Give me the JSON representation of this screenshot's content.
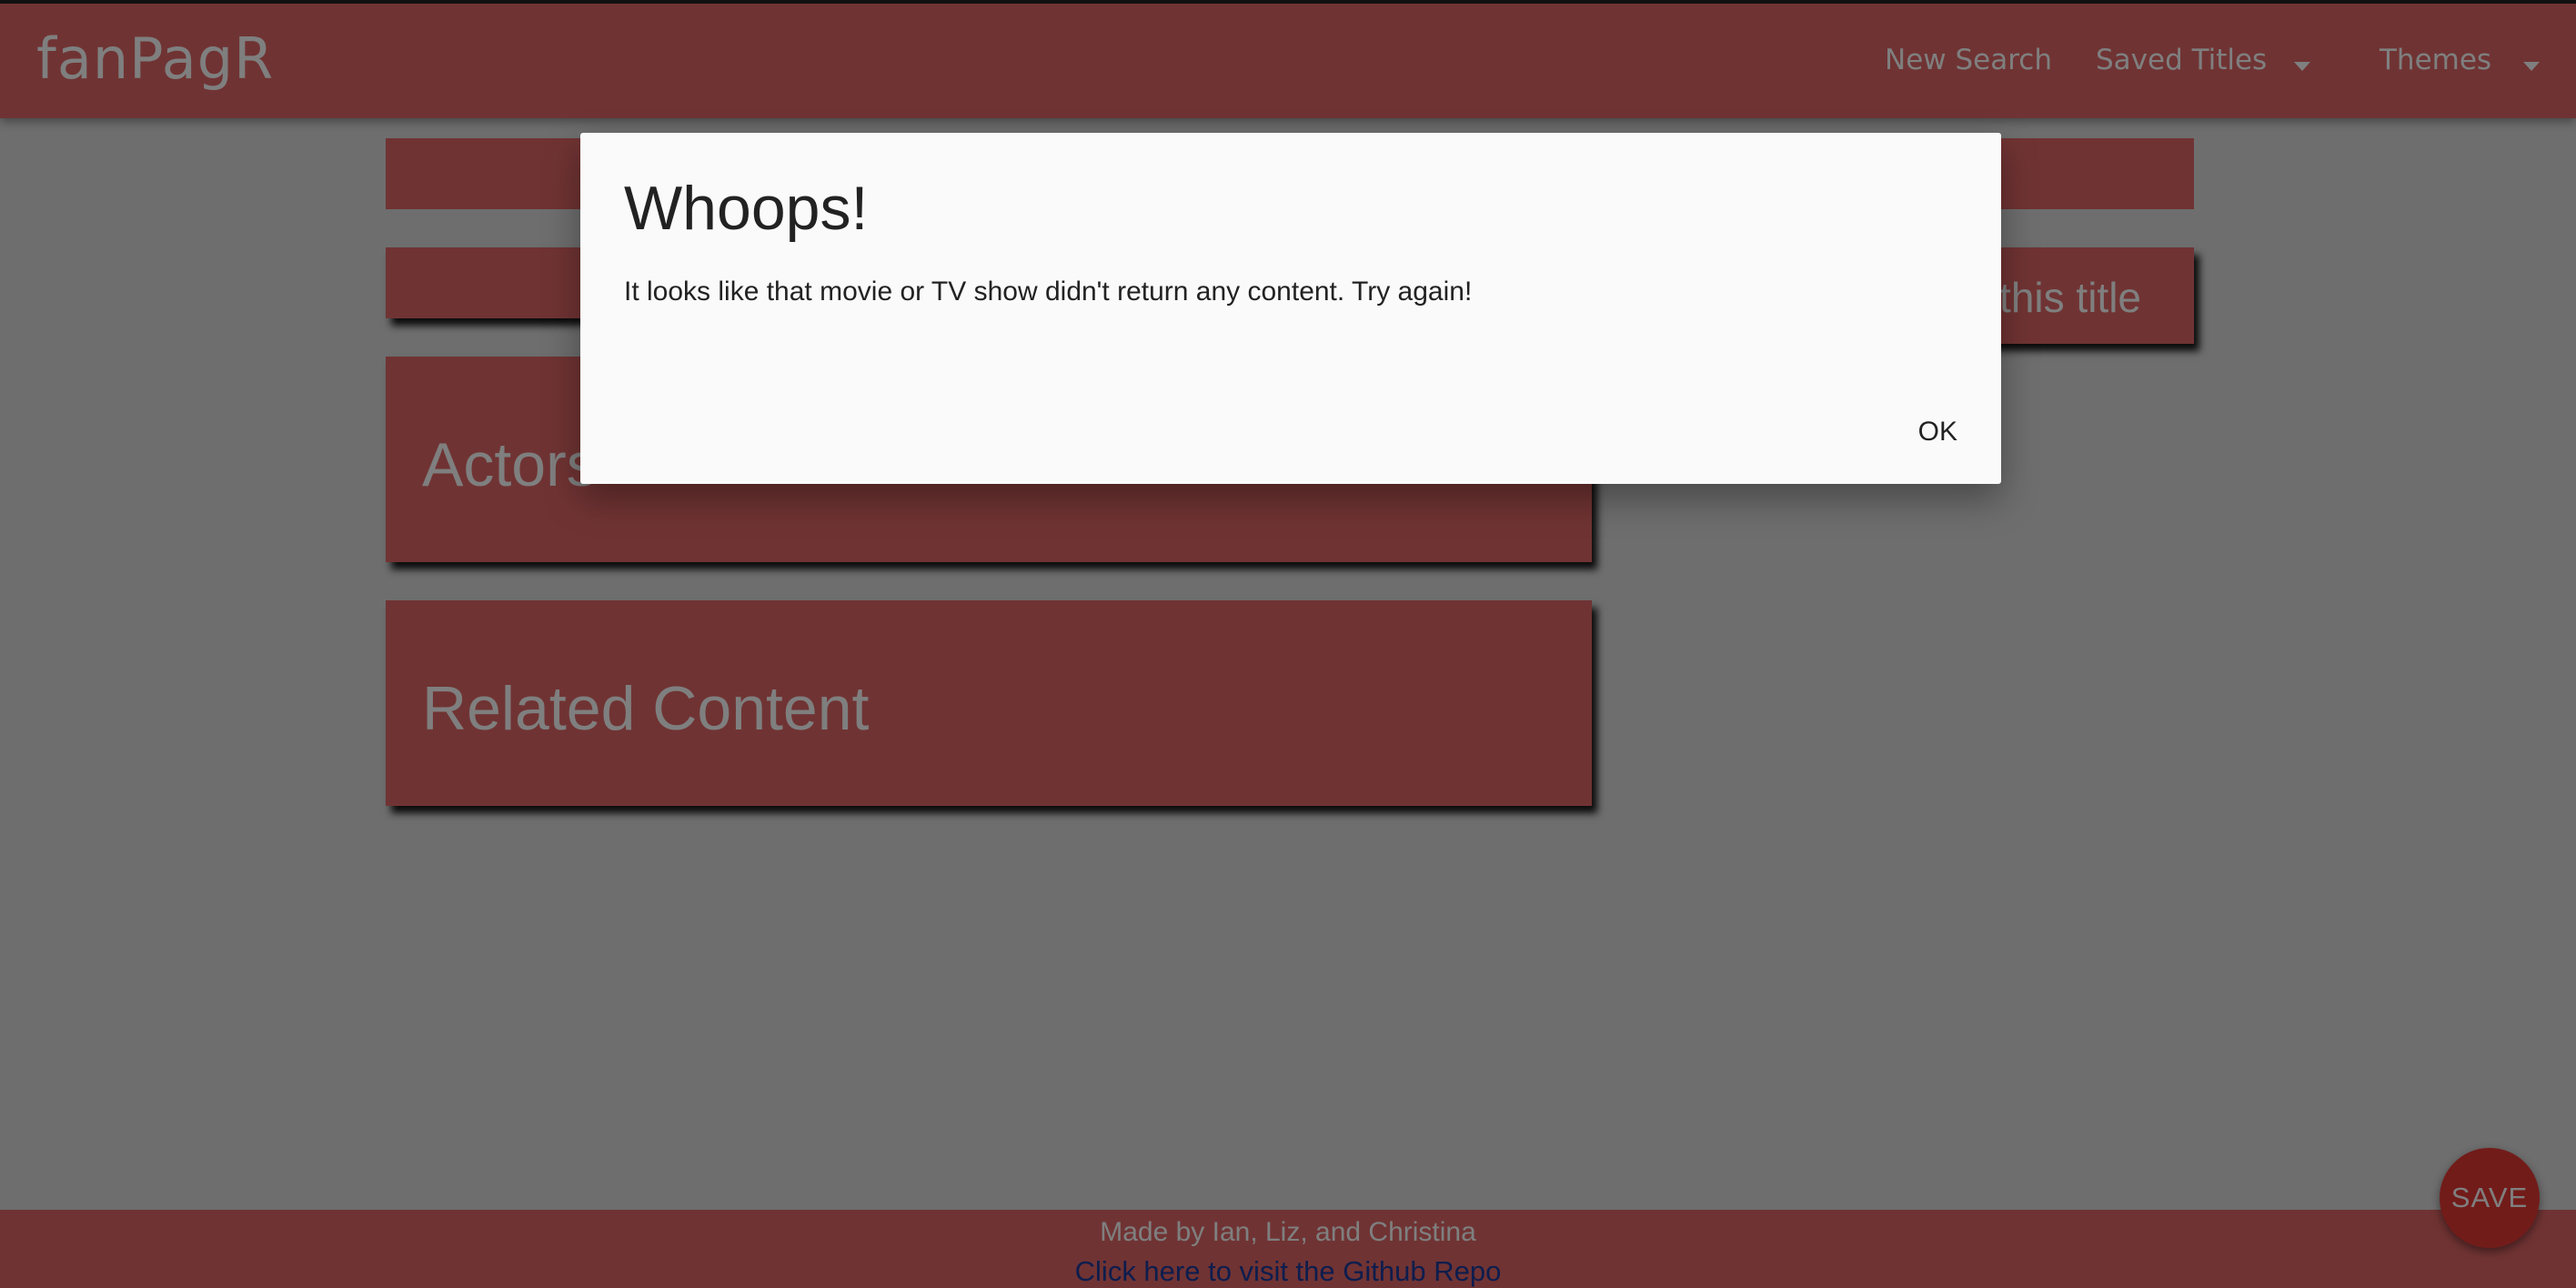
{
  "navbar": {
    "brand": "fanPagR",
    "links": {
      "new_search": "New Search",
      "saved_titles": "Saved Titles",
      "themes": "Themes"
    }
  },
  "main": {
    "side_card_text": "this title",
    "actors_heading": "Actors",
    "related_heading": "Related Content"
  },
  "footer": {
    "credit": "Made by Ian, Liz, and Christina",
    "repo_link": "Click here to visit the Github Repo"
  },
  "fab": {
    "label": "SAVE"
  },
  "modal": {
    "title": "Whoops!",
    "message": "It looks like that movie or TV show didn't return any content. Try again!",
    "ok_label": "OK"
  },
  "colors": {
    "theme": "#e06666",
    "fab": "#e53935",
    "link": "#1a3a9a",
    "overlay": "rgba(0,0,0,0.5)"
  },
  "icons": {
    "saved_titles_dropdown": "caret-down-icon",
    "themes_dropdown": "caret-down-icon"
  }
}
